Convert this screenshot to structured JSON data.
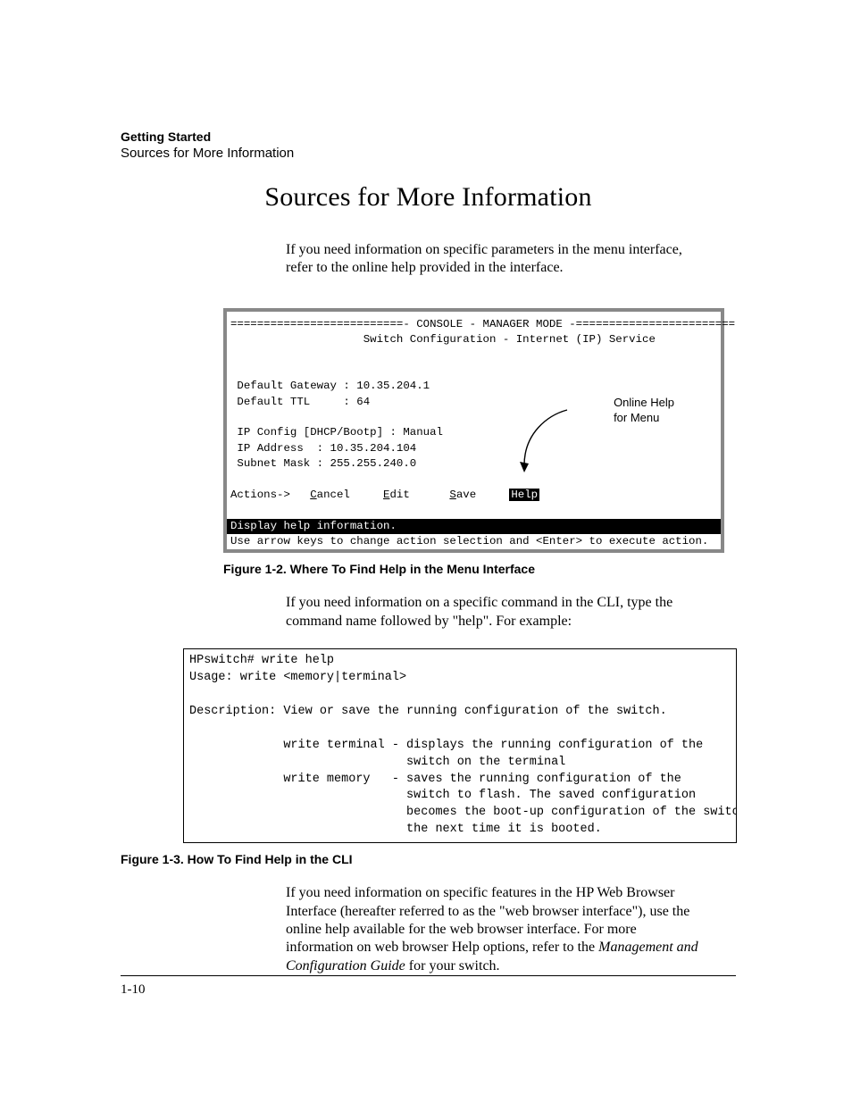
{
  "header": {
    "chapter": "Getting Started",
    "section": "Sources for More Information"
  },
  "title": "Sources for More Information",
  "para1": "If you need information on specific parameters in the menu interface, refer to the online help provided in the interface.",
  "console": {
    "rule_top": "==========================- CONSOLE - MANAGER MODE -========================",
    "subtitle": "                    Switch Configuration - Internet (IP) Service",
    "r_gateway": " Default Gateway : 10.35.204.1",
    "r_ttl": " Default TTL     : 64",
    "r_ipcfg": " IP Config [DHCP/Bootp] : Manual",
    "r_ipaddr": " IP Address  : 10.35.204.104",
    "r_subnet": " Subnet Mask : 255.255.240.0",
    "actions_prefix": "Actions->   ",
    "a_cancel_u": "C",
    "a_cancel_r": "ancel",
    "a_edit_u": "E",
    "a_edit_r": "dit",
    "a_save_u": "S",
    "a_save_r": "ave",
    "a_help": "Help",
    "gap1": "     ",
    "gap2": "      ",
    "gap3": "     ",
    "status1": "Display help information.                                                  ",
    "status2": "Use arrow keys to change action selection and <Enter> to execute action.",
    "callout_l1": "Online Help",
    "callout_l2": "for Menu"
  },
  "fig1_caption": "Figure 1-2. Where To Find Help in the Menu Interface",
  "para2": "If you need information on a specific command in the CLI, type the command name followed by \"help\". For example:",
  "cli_text": "HPswitch# write help\nUsage: write <memory|terminal>\n\nDescription: View or save the running configuration of the switch.\n\n             write terminal - displays the running configuration of the\n                              switch on the terminal\n             write memory   - saves the running configuration of the\n                              switch to flash. The saved configuration\n                              becomes the boot-up configuration of the switch\n                              the next time it is booted.",
  "fig2_caption": "Figure 1-3. How To Find Help in the CLI",
  "para3_a": "If you need information on specific features in the HP Web Browser Interface (hereafter referred to as the \"web browser interface\"), use the online help available for the web browser interface. For more information on web browser Help options, refer to the ",
  "para3_ital": "Management and Configuration Guide",
  "para3_b": " for your switch.",
  "page_number": "1-10"
}
